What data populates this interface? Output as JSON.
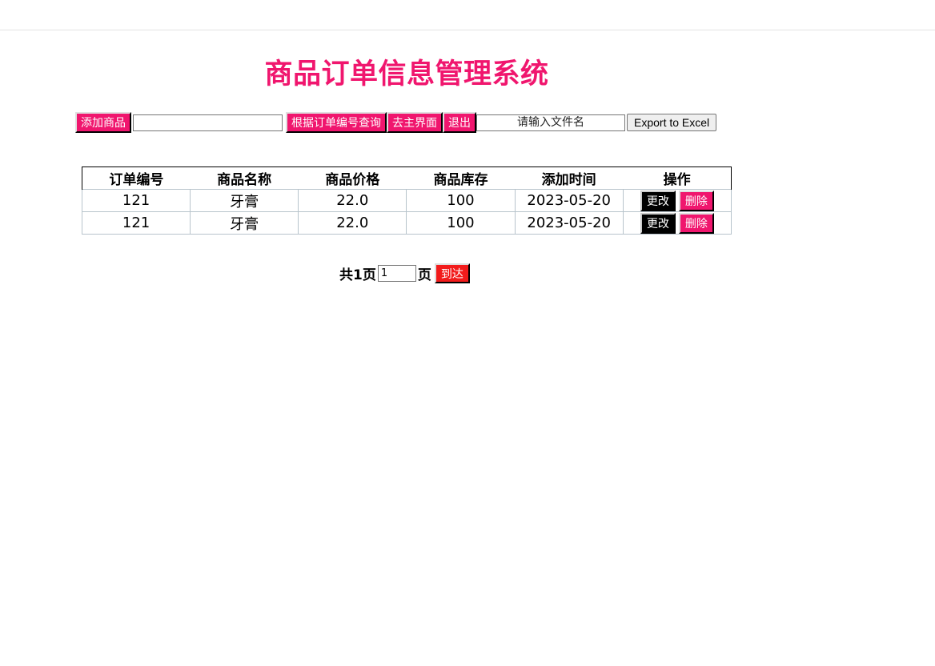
{
  "title": "商品订单信息管理系统",
  "toolbar": {
    "add_label": "添加商品",
    "search_value": "",
    "search_by_id_label": "根据订单编号查询",
    "home_label": "去主界面",
    "logout_label": "退出",
    "filename_placeholder": "请输入文件名",
    "export_label": "Export to Excel"
  },
  "table": {
    "headers": [
      "订单编号",
      "商品名称",
      "商品价格",
      "商品库存",
      "添加时间",
      "操作"
    ],
    "rows": [
      {
        "id": "121",
        "name": "牙膏",
        "price": "22.0",
        "stock": "100",
        "date": "2023-05-20",
        "edit_label": "更改",
        "delete_label": "删除"
      },
      {
        "id": "121",
        "name": "牙膏",
        "price": "22.0",
        "stock": "100",
        "date": "2023-05-20",
        "edit_label": "更改",
        "delete_label": "删除"
      }
    ]
  },
  "pager": {
    "total_text": "共1页",
    "page_value": "1",
    "page_suffix": "页",
    "go_label": "到达"
  },
  "colors": {
    "accent": "#f0166e",
    "go_button": "#f21b1b"
  }
}
